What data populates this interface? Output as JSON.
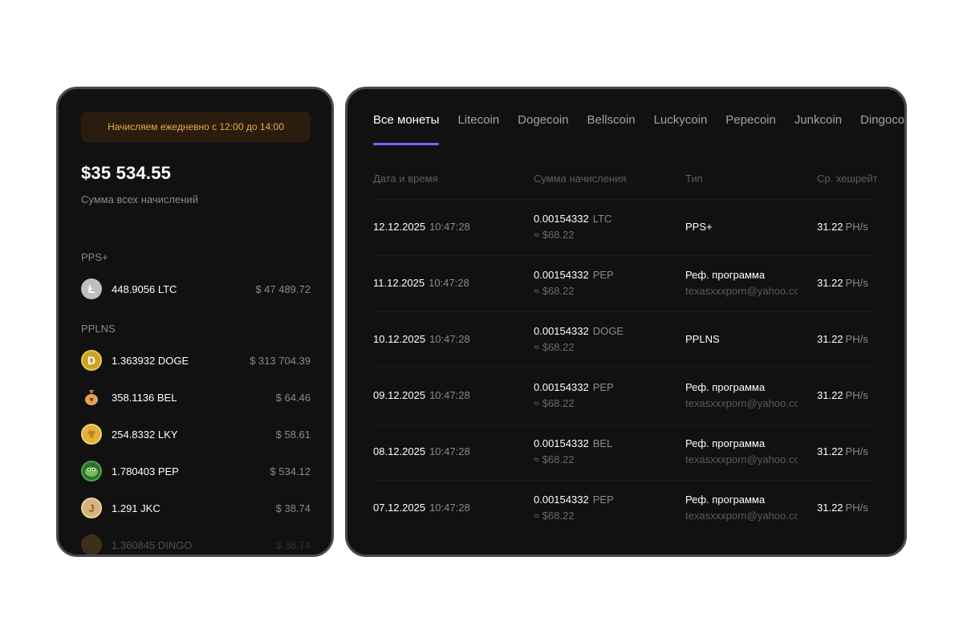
{
  "left": {
    "notice": "Начисляем ежедневно с 12:00 до 14:00",
    "total": "$35 534.55",
    "total_label": "Сумма всех начислений",
    "pps_label": "PPS+",
    "pps_items": [
      {
        "amount": "448.9056 LTC",
        "usd": "$ 47 489.72",
        "icon": "litecoin-icon",
        "color": "#bfbfbf"
      }
    ],
    "pplns_label": "PPLNS",
    "pplns_items": [
      {
        "amount": "1.363932 DOGE",
        "usd": "$ 313 704.39",
        "icon": "dogecoin-icon",
        "color": "#c9a227"
      },
      {
        "amount": "358.1136 BEL",
        "usd": "$ 64.46",
        "icon": "bellscoin-icon",
        "color": "#e8a15a"
      },
      {
        "amount": "254.8332 LKY",
        "usd": "$ 58.61",
        "icon": "luckycoin-icon",
        "color": "#e2b33a"
      },
      {
        "amount": "1.780403 PEP",
        "usd": "$ 534.12",
        "icon": "pepecoin-icon",
        "color": "#3f8f3a"
      },
      {
        "amount": "1.291 JKC",
        "usd": "$ 38.74",
        "icon": "junkcoin-icon",
        "color": "#d9b27a"
      },
      {
        "amount": "1.360845 DINGO",
        "usd": "$ 36.74",
        "icon": "dingocoin-icon",
        "color": "#c88a3a"
      }
    ]
  },
  "right": {
    "tabs": [
      "Все монеты",
      "Litecoin",
      "Dogecoin",
      "Bellscoin",
      "Luckycoin",
      "Pepecoin",
      "Junkcoin",
      "Dingocoin"
    ],
    "active_tab": 0,
    "accent": "#8b5cf6",
    "headers": {
      "date": "Дата и время",
      "amount": "Сумма начисления",
      "type": "Тип",
      "hashrate": "Ср. хешрейт"
    },
    "rows": [
      {
        "date": "12.12.2025",
        "time": "10:47:28",
        "amount": "0.00154332",
        "ticker": "LTC",
        "usd": "≈ $68.22",
        "type": "PPS+",
        "email": "",
        "hash": "31.22",
        "unit": "PH/s"
      },
      {
        "date": "11.12.2025",
        "time": "10:47:28",
        "amount": "0.00154332",
        "ticker": "PEP",
        "usd": "≈ $68.22",
        "type": "Реф. программа",
        "email": "texasxxxporn@yahoo.com",
        "hash": "31.22",
        "unit": "PH/s"
      },
      {
        "date": "10.12.2025",
        "time": "10:47:28",
        "amount": "0.00154332",
        "ticker": "DOGE",
        "usd": "≈ $68.22",
        "type": "PPLNS",
        "email": "",
        "hash": "31.22",
        "unit": "PH/s"
      },
      {
        "date": "09.12.2025",
        "time": "10:47:28",
        "amount": "0.00154332",
        "ticker": "PEP",
        "usd": "≈ $68.22",
        "type": "Реф. программа",
        "email": "texasxxxporn@yahoo.com",
        "hash": "31.22",
        "unit": "PH/s"
      },
      {
        "date": "08.12.2025",
        "time": "10:47:28",
        "amount": "0.00154332",
        "ticker": "BEL",
        "usd": "≈ $68.22",
        "type": "Реф. программа",
        "email": "texasxxxporn@yahoo.com",
        "hash": "31.22",
        "unit": "PH/s"
      },
      {
        "date": "07.12.2025",
        "time": "10:47:28",
        "amount": "0.00154332",
        "ticker": "PEP",
        "usd": "≈ $68.22",
        "type": "Реф. программа",
        "email": "texasxxxporn@yahoo.com",
        "hash": "31.22",
        "unit": "PH/s"
      }
    ]
  }
}
